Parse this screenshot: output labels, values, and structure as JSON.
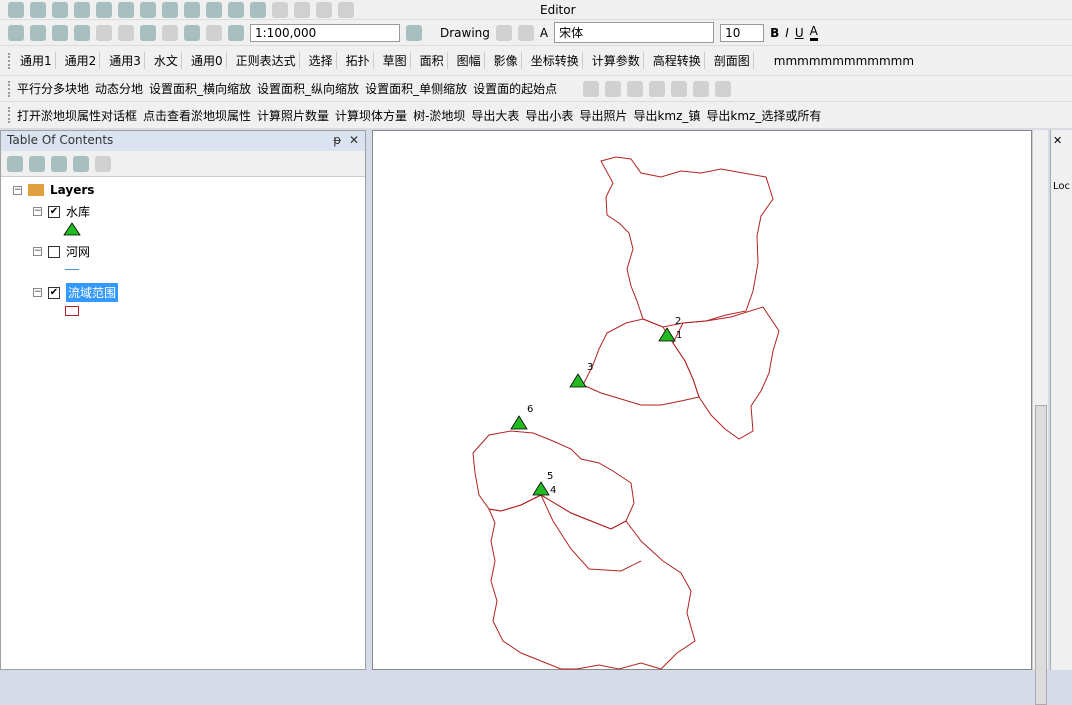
{
  "toolbar1": {
    "editor": "Editor"
  },
  "toolbar2": {
    "scale": "1:100,000",
    "drawing": "Drawing",
    "font": "宋体",
    "font_size": "10",
    "bold": "B",
    "italic": "I",
    "underline": "U",
    "font_color": "A"
  },
  "toolbar3": [
    "通用1",
    "通用2",
    "通用3",
    "水文",
    "通用0",
    "正则表达式",
    "选择",
    "拓扑",
    "草图",
    "面积",
    "图幅",
    "影像",
    "坐标转换",
    "计算参数",
    "高程转换",
    "剖面图"
  ],
  "toolbar3_extra": "mmmmmmmmmmmm",
  "toolbar4": [
    "平行分多块地",
    "动态分地",
    "设置面积_横向缩放",
    "设置面积_纵向缩放",
    "设置面积_单侧缩放",
    "设置面的起始点"
  ],
  "toolbar5": [
    "打开淤地坝属性对话框",
    "点击查看淤地坝属性",
    "计算照片数量",
    "计算坝体方量",
    "树-淤地坝",
    "导出大表",
    "导出小表",
    "导出照片",
    "导出kmz_镇",
    "导出kmz_选择或所有"
  ],
  "toc": {
    "title": "Table Of Contents",
    "pin": "ᵽ",
    "close": "✕",
    "root": "Layers",
    "layers": [
      {
        "name": "水库",
        "checked": true,
        "symbol": "green-triangle"
      },
      {
        "name": "河网",
        "checked": false,
        "symbol": "blue-line"
      },
      {
        "name": "流域范围",
        "checked": true,
        "selected": true,
        "symbol": "red-outline-polygon"
      }
    ]
  },
  "map": {
    "points": [
      {
        "label": "1"
      },
      {
        "label": "2"
      },
      {
        "label": "3"
      },
      {
        "label": "4"
      },
      {
        "label": "5"
      },
      {
        "label": "6"
      }
    ],
    "colors": {
      "polygon": "#b22222",
      "point": "#22bb22"
    }
  },
  "right_panel": {
    "text": "Loc"
  }
}
